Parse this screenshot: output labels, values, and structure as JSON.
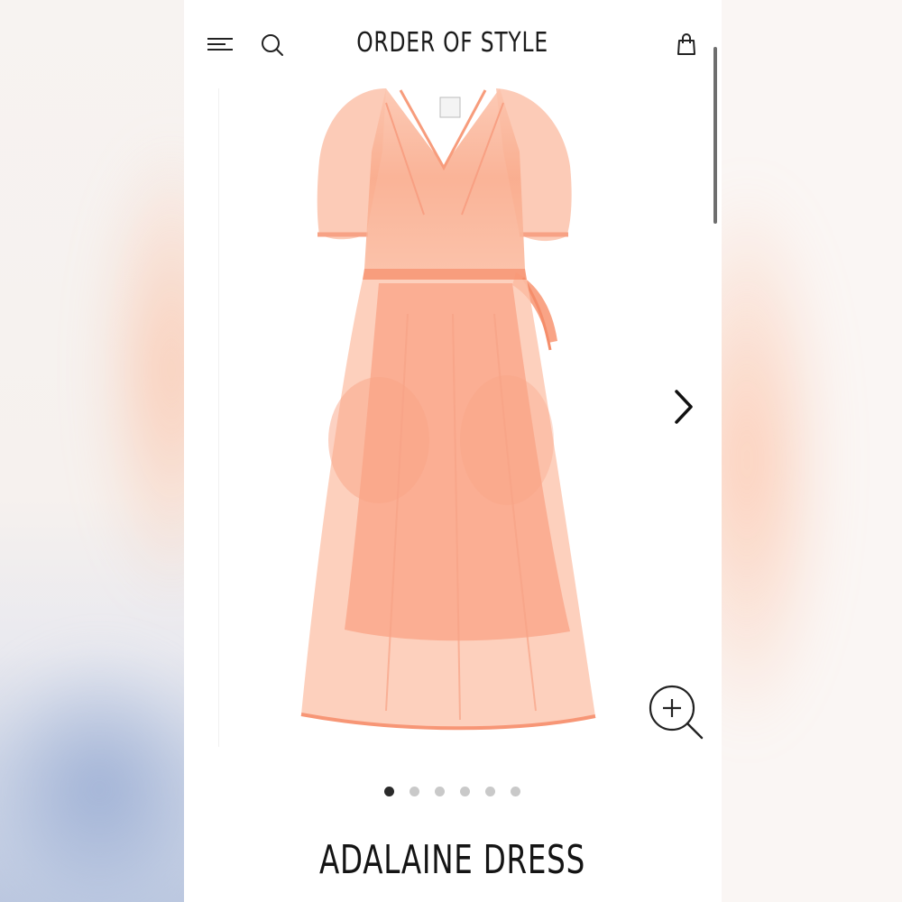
{
  "brand": {
    "name": "ORDER OF STYLE"
  },
  "header": {
    "menu_icon": "hamburger-menu-icon",
    "search_icon": "search-icon",
    "bag_icon": "shopping-bag-icon"
  },
  "gallery": {
    "image": "peach-organza-wrap-dress",
    "image_count": 6,
    "active_index": 0,
    "next_icon": "chevron-right-icon",
    "zoom_icon": "zoom-in-icon"
  },
  "product": {
    "title": "ADALAINE DRESS"
  },
  "colors": {
    "dress": "#f9a98a",
    "text": "#1b1b1b",
    "dot_active": "#2a2a2a",
    "dot_inactive": "#c9c9c9"
  }
}
